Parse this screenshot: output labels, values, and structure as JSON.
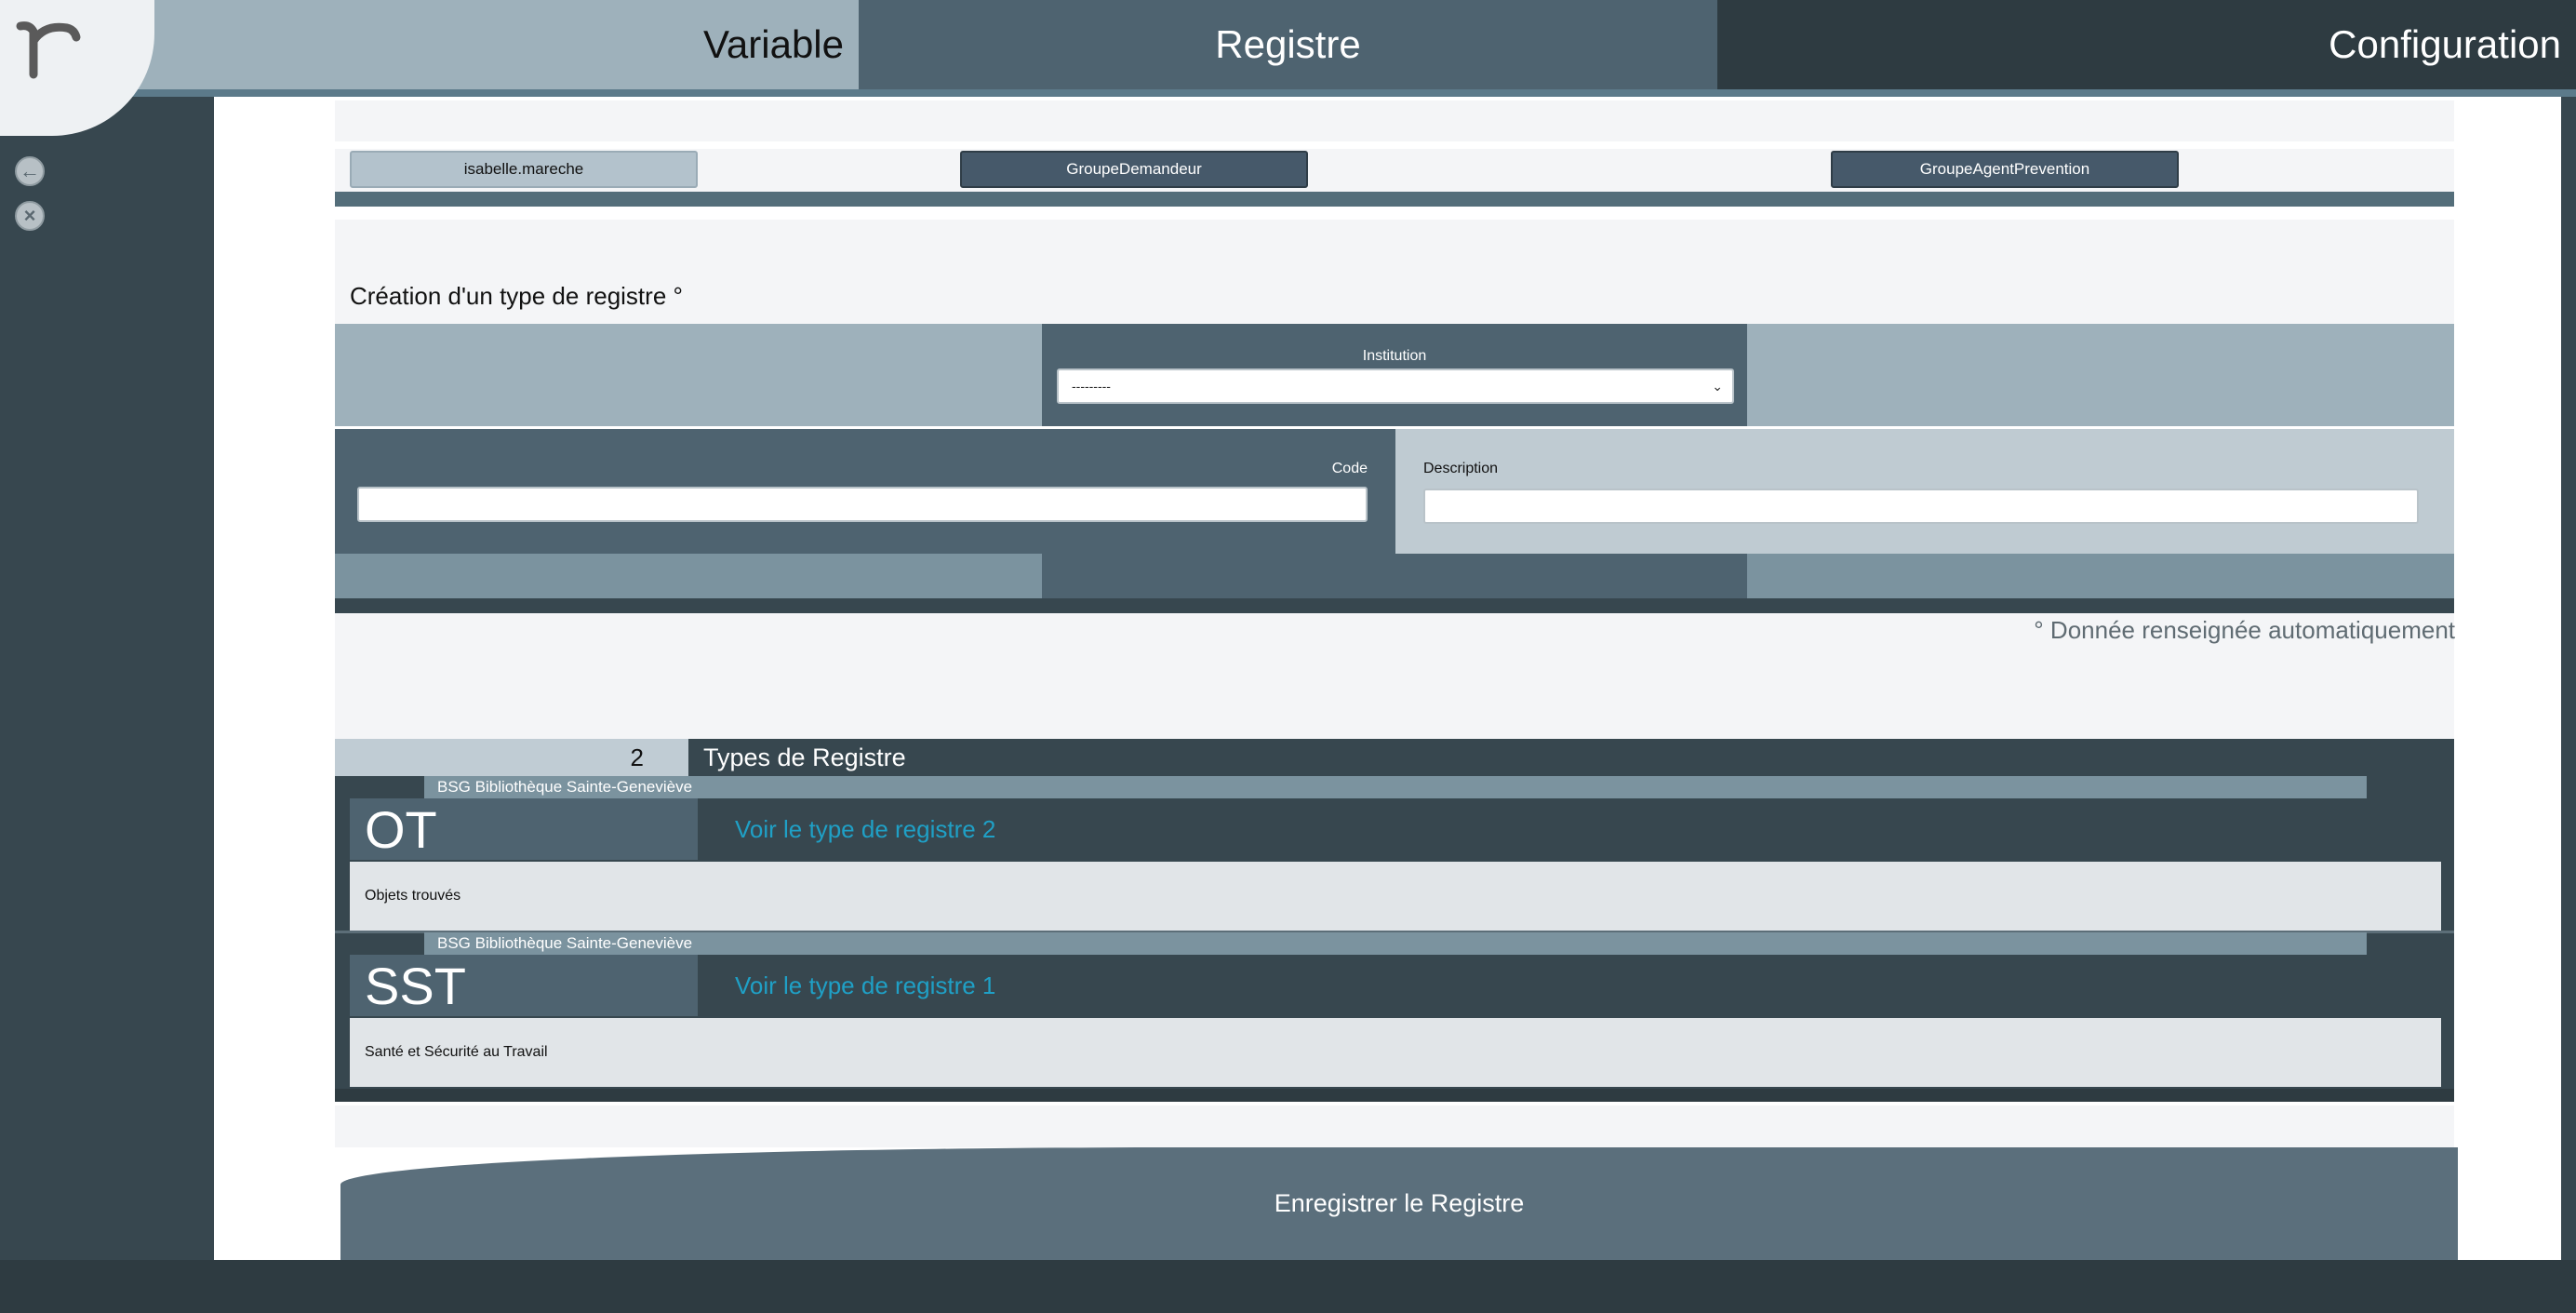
{
  "nav": {
    "tabs": [
      {
        "label": "Variable"
      },
      {
        "label": "Registre"
      },
      {
        "label": "Configuration"
      }
    ]
  },
  "sidebar": {
    "back_icon": "arrow-left-icon",
    "close_icon": "close-icon"
  },
  "user_bar": {
    "user": "isabelle.mareche",
    "groups": [
      "GroupeDemandeur",
      "GroupeAgentPrevention"
    ]
  },
  "form": {
    "title": "Création d'un type de registre °",
    "institution_label": "Institution",
    "institution_value": "---------",
    "code_label": "Code",
    "code_value": "",
    "description_label": "Description",
    "description_value": "",
    "auto_note": "° Donnée renseignée automatiquement"
  },
  "register_list": {
    "count": "2",
    "title": "Types de Registre",
    "items": [
      {
        "institution": "BSG Bibliothèque Sainte-Geneviève",
        "code": "OT",
        "link": "Voir le type de registre 2",
        "description": "Objets trouvés"
      },
      {
        "institution": "BSG Bibliothèque Sainte-Geneviève",
        "code": "SST",
        "link": "Voir le type de registre 1",
        "description": "Santé et Sécurité au Travail"
      }
    ]
  },
  "actions": {
    "save_label": "Enregistrer le Registre"
  },
  "colors": {
    "accent_link": "#1fa0c6",
    "dark_slate": "#37474f",
    "mid_slate": "#4e6370",
    "light_slate": "#9eb1bb"
  }
}
